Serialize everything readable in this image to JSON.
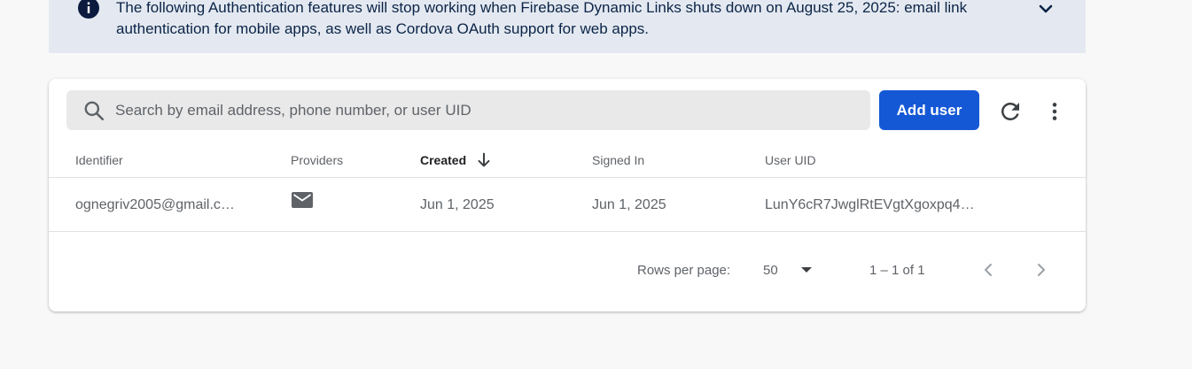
{
  "banner": {
    "message": "The following Authentication features will stop working when Firebase Dynamic Links shuts down on August 25, 2025: email link authentication for mobile apps, as well as Cordova OAuth support for web apps."
  },
  "search": {
    "placeholder": "Search by email address, phone number, or user UID",
    "value": ""
  },
  "toolbar": {
    "add_user_label": "Add user"
  },
  "table": {
    "columns": [
      "Identifier",
      "Providers",
      "Created",
      "Signed In",
      "User UID"
    ],
    "sorted_column": "Created",
    "rows": [
      {
        "identifier": "ognegriv2005@gmail.c…",
        "provider_icon": "mail-icon",
        "created": "Jun 1, 2025",
        "signed_in": "Jun 1, 2025",
        "uid": "LunY6cR7JwglRtEVgtXgoxpq4…"
      }
    ]
  },
  "pagination": {
    "rows_per_page_label": "Rows per page:",
    "rows_per_page": "50",
    "range": "1 – 1 of 1"
  },
  "colors": {
    "banner_bg": "#e4e9f1",
    "primary": "#1558d6",
    "page_bg": "#f8f8f8"
  }
}
